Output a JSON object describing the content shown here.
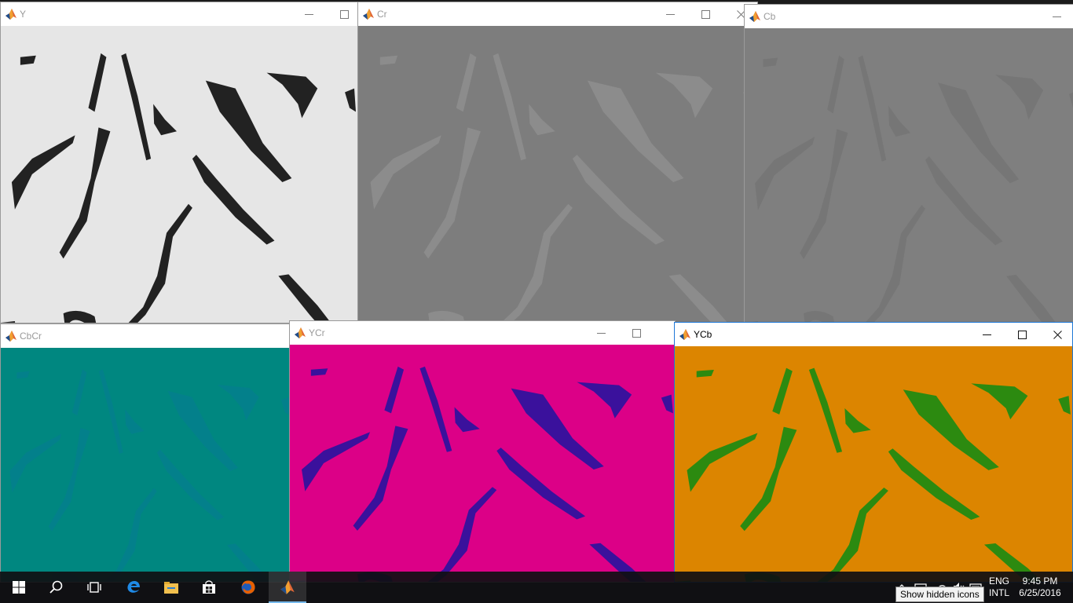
{
  "windows": {
    "y": {
      "title": "Y"
    },
    "cr": {
      "title": "Cr"
    },
    "cb": {
      "title": "Cb"
    },
    "cbcr": {
      "title": "CbCr"
    },
    "ycr": {
      "title": "YCr"
    },
    "ycb": {
      "title": "YCb"
    }
  },
  "panel_colors": {
    "y_bg": "#e6e6e6",
    "y_fg": "#222222",
    "cr_bg": "#7d7d7d",
    "cr_fg": "#8e8e8e",
    "cb_bg": "#7f7f7f",
    "cb_fg": "#747474",
    "cbcr_bg": "#008780",
    "cbcr_fg": "#0a74a2",
    "ycr_bg": "#dc0087",
    "ycr_fg": "#3a119c",
    "ycb_bg": "#dc8500",
    "ycb_fg": "#2c8a10"
  },
  "taskbar": {
    "apps": [
      "start-icon",
      "search-icon",
      "task-view-icon",
      "edge-icon",
      "file-explorer-icon",
      "store-icon",
      "firefox-icon",
      "matlab-icon"
    ],
    "active_app": "matlab-icon",
    "language": [
      "ENG",
      "INTL"
    ],
    "time": "9:45 PM",
    "date": "6/25/2016",
    "tooltip": "Show hidden icons"
  }
}
